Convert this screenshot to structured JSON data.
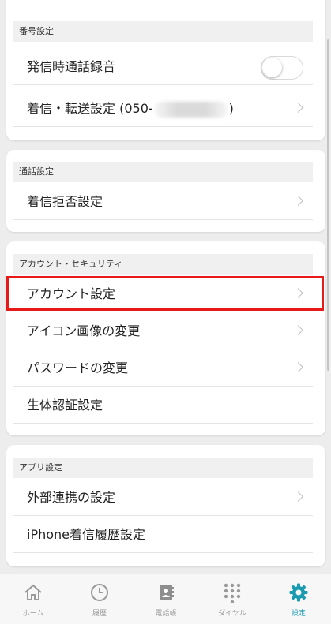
{
  "sections": {
    "number": {
      "header": "番号設定",
      "call_recording": "発信時通話録音",
      "forwarding_prefix": "着信・転送設定 (050-",
      "forwarding_suffix": ")"
    },
    "call": {
      "header": "通話設定",
      "block": "着信拒否設定"
    },
    "account": {
      "header": "アカウント・セキュリティ",
      "account_settings": "アカウント設定",
      "icon_change": "アイコン画像の変更",
      "password_change": "パスワードの変更",
      "biometric": "生体認証設定"
    },
    "app": {
      "header": "アプリ設定",
      "integration": "外部連携の設定",
      "iphone_history": "iPhone着信履歴設定"
    }
  },
  "toggle": {
    "call_recording_on": false
  },
  "tabbar": {
    "home": "ホーム",
    "history": "履歴",
    "contacts": "電話帳",
    "dial": "ダイヤル",
    "settings": "設定"
  },
  "colors": {
    "active_tab": "#1a9bb0",
    "highlight": "#e81919"
  },
  "icons": [
    "home-icon",
    "clock-icon",
    "contacts-book-icon",
    "dialpad-icon",
    "gear-icon",
    "chevron-right-icon"
  ]
}
